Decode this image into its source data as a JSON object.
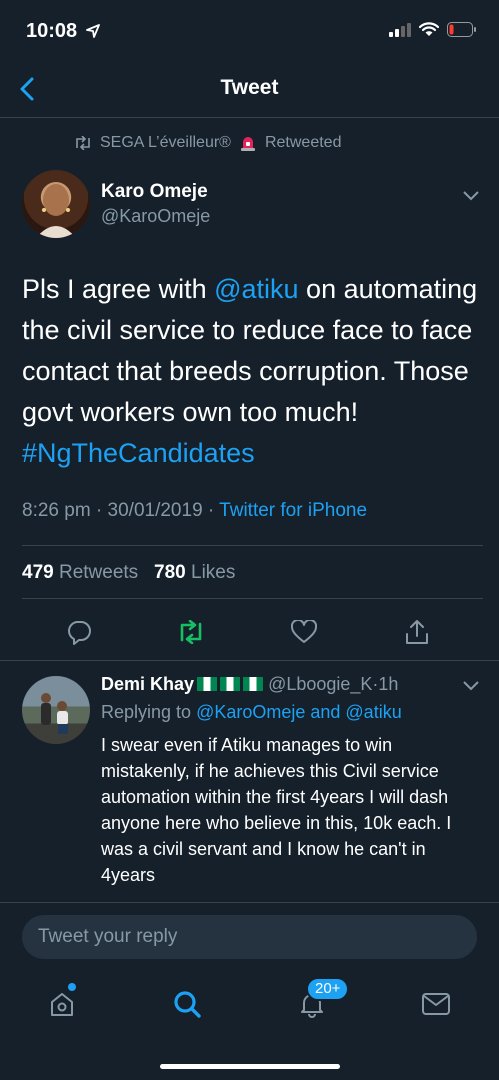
{
  "status_bar": {
    "time": "10:08"
  },
  "nav": {
    "title": "Tweet"
  },
  "retweet_banner": {
    "user": "SEGA L’éveilleur®",
    "action": "Retweeted"
  },
  "tweet": {
    "author_name": "Karo Omeje",
    "author_handle": "@KaroOmeje",
    "text_1": "Pls I agree with ",
    "mention": "@atiku",
    "text_2": " on automating the civil service to reduce face to face contact that breeds corruption. Those govt workers own too much!",
    "hashtag": "#NgTheCandidates",
    "timestamp": "8:26 pm · 30/01/2019 · ",
    "source": "Twitter for iPhone",
    "retweets_count": "479",
    "retweets_label": "Retweets",
    "likes_count": "780",
    "likes_label": "Likes"
  },
  "reply": {
    "author_name": "Demi Khay",
    "author_handle": "@Lboogie_K",
    "time": "1h",
    "replying_to_label": "Replying to ",
    "replying_to_users": "@KaroOmeje and @atiku",
    "text": "I swear even if Atiku manages to win mistakenly, if he achieves this Civil service automation within the first 4years I will dash anyone here who believe in this, 10k each. I was a civil servant and I know he can't in 4years"
  },
  "reply_box": {
    "placeholder": "Tweet your reply"
  },
  "tabbar": {
    "notifications_badge": "20+"
  },
  "colors": {
    "background": "#15202b",
    "accent": "#1da1f2",
    "muted": "#8899a6",
    "retweet_green": "#17bf63"
  }
}
